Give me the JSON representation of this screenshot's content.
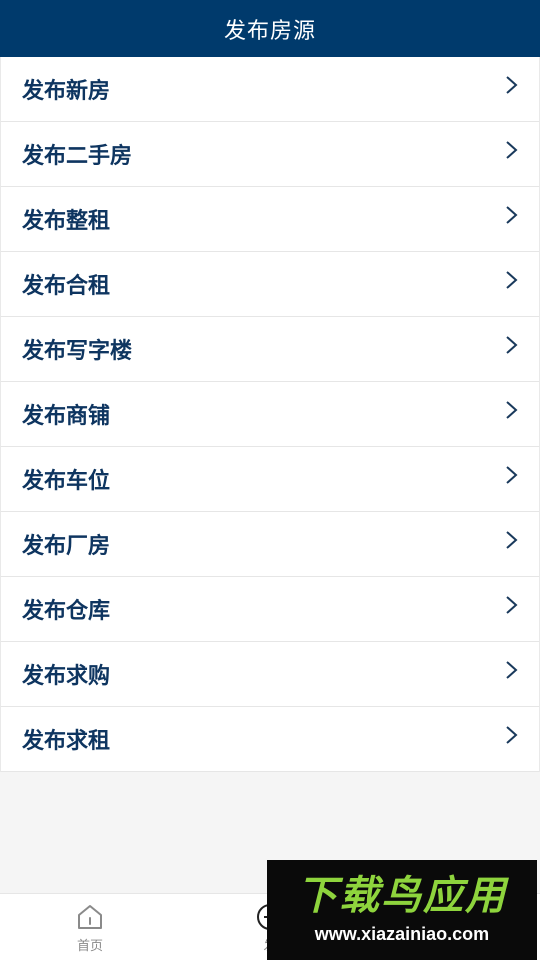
{
  "header": {
    "title": "发布房源"
  },
  "menu": {
    "items": [
      {
        "label": "发布新房"
      },
      {
        "label": "发布二手房"
      },
      {
        "label": "发布整租"
      },
      {
        "label": "发布合租"
      },
      {
        "label": "发布写字楼"
      },
      {
        "label": "发布商铺"
      },
      {
        "label": "发布车位"
      },
      {
        "label": "发布厂房"
      },
      {
        "label": "发布仓库"
      },
      {
        "label": "发布求购"
      },
      {
        "label": "发布求租"
      }
    ]
  },
  "tabbar": {
    "home": {
      "label": "首页",
      "icon": "home-icon"
    },
    "publish": {
      "label": "发",
      "icon": "plus-circle-icon"
    }
  },
  "watermark": {
    "title": "下载鸟应用",
    "url": "www.xiazainiao.com"
  },
  "colors": {
    "header_bg": "#003a6c",
    "menu_text": "#0e3560",
    "watermark_green": "#8ed43d"
  }
}
